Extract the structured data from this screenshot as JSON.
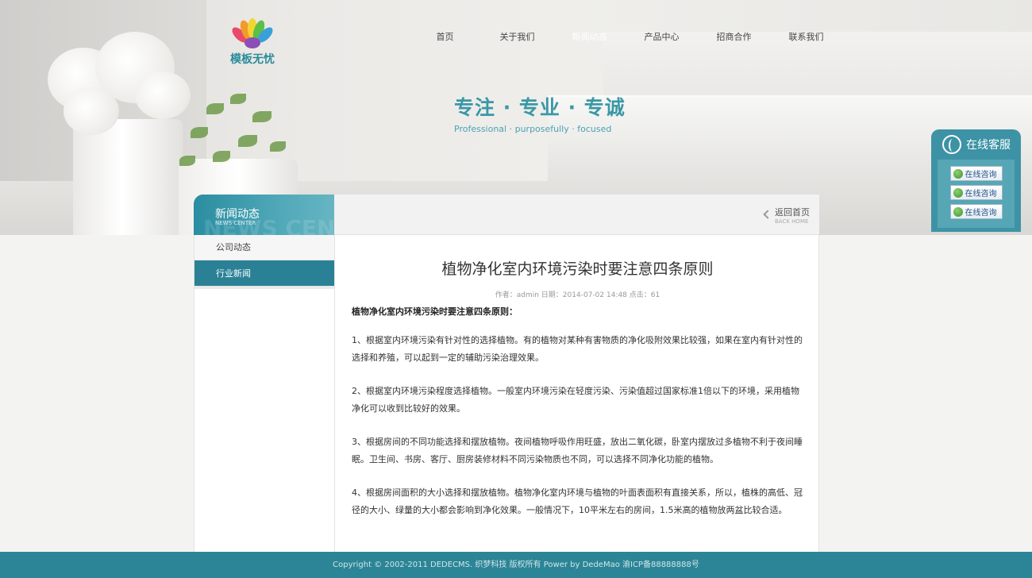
{
  "logo": {
    "text": "模板无忧"
  },
  "nav": {
    "items": [
      {
        "label": "首页"
      },
      {
        "label": "关于我们"
      },
      {
        "label": "新闻动态"
      },
      {
        "label": "产品中心"
      },
      {
        "label": "招商合作"
      },
      {
        "label": "联系我们"
      }
    ],
    "active_index": 2
  },
  "slogan": {
    "cn": "专注 · 专业 · 专诚",
    "en": "Professional · purposefully · focused"
  },
  "service": {
    "title": "在线客服",
    "buttons": [
      "在线咨询",
      "在线咨询",
      "在线咨询"
    ]
  },
  "sidebar": {
    "title_cn": "新闻动态",
    "title_en": "NEWS CENTER",
    "bg_text": "NEWS CEN",
    "items": [
      {
        "label": "公司动态"
      },
      {
        "label": "行业新闻"
      }
    ],
    "active_index": 1
  },
  "main": {
    "back_cn": "返回首页",
    "back_en": "BACK HOME",
    "title": "植物净化室内环境污染时要注意四条原则",
    "meta": "作者：admin 日期：2014-07-02 14:48 点击：61",
    "lead": "植物净化室内环境污染时要注意四条原则：",
    "paragraphs": [
      "1、根据室内环境污染有针对性的选择植物。有的植物对某种有害物质的净化吸附效果比较强，如果在室内有针对性的选择和养殖，可以起到一定的辅助污染治理效果。",
      "2、根据室内环境污染程度选择植物。一般室内环境污染在轻度污染、污染值超过国家标准1倍以下的环境，采用植物净化可以收到比较好的效果。",
      "3、根据房间的不同功能选择和摆放植物。夜间植物呼吸作用旺盛，放出二氧化碳，卧室内摆放过多植物不利于夜间睡眠。卫生间、书房、客厅、厨房装修材料不同污染物质也不同，可以选择不同净化功能的植物。",
      "4、根据房间面积的大小选择和摆放植物。植物净化室内环境与植物的叶面表面积有直接关系，所以，植株的高低、冠径的大小、绿量的大小都会影响到净化效果。一般情况下，10平米左右的房间，1.5米高的植物放两盆比较合适。"
    ]
  },
  "footer": {
    "text": "Copyright © 2002-2011 DEDECMS. 织梦科技 版权所有 Power by DedeMao   渝ICP备88888888号"
  }
}
